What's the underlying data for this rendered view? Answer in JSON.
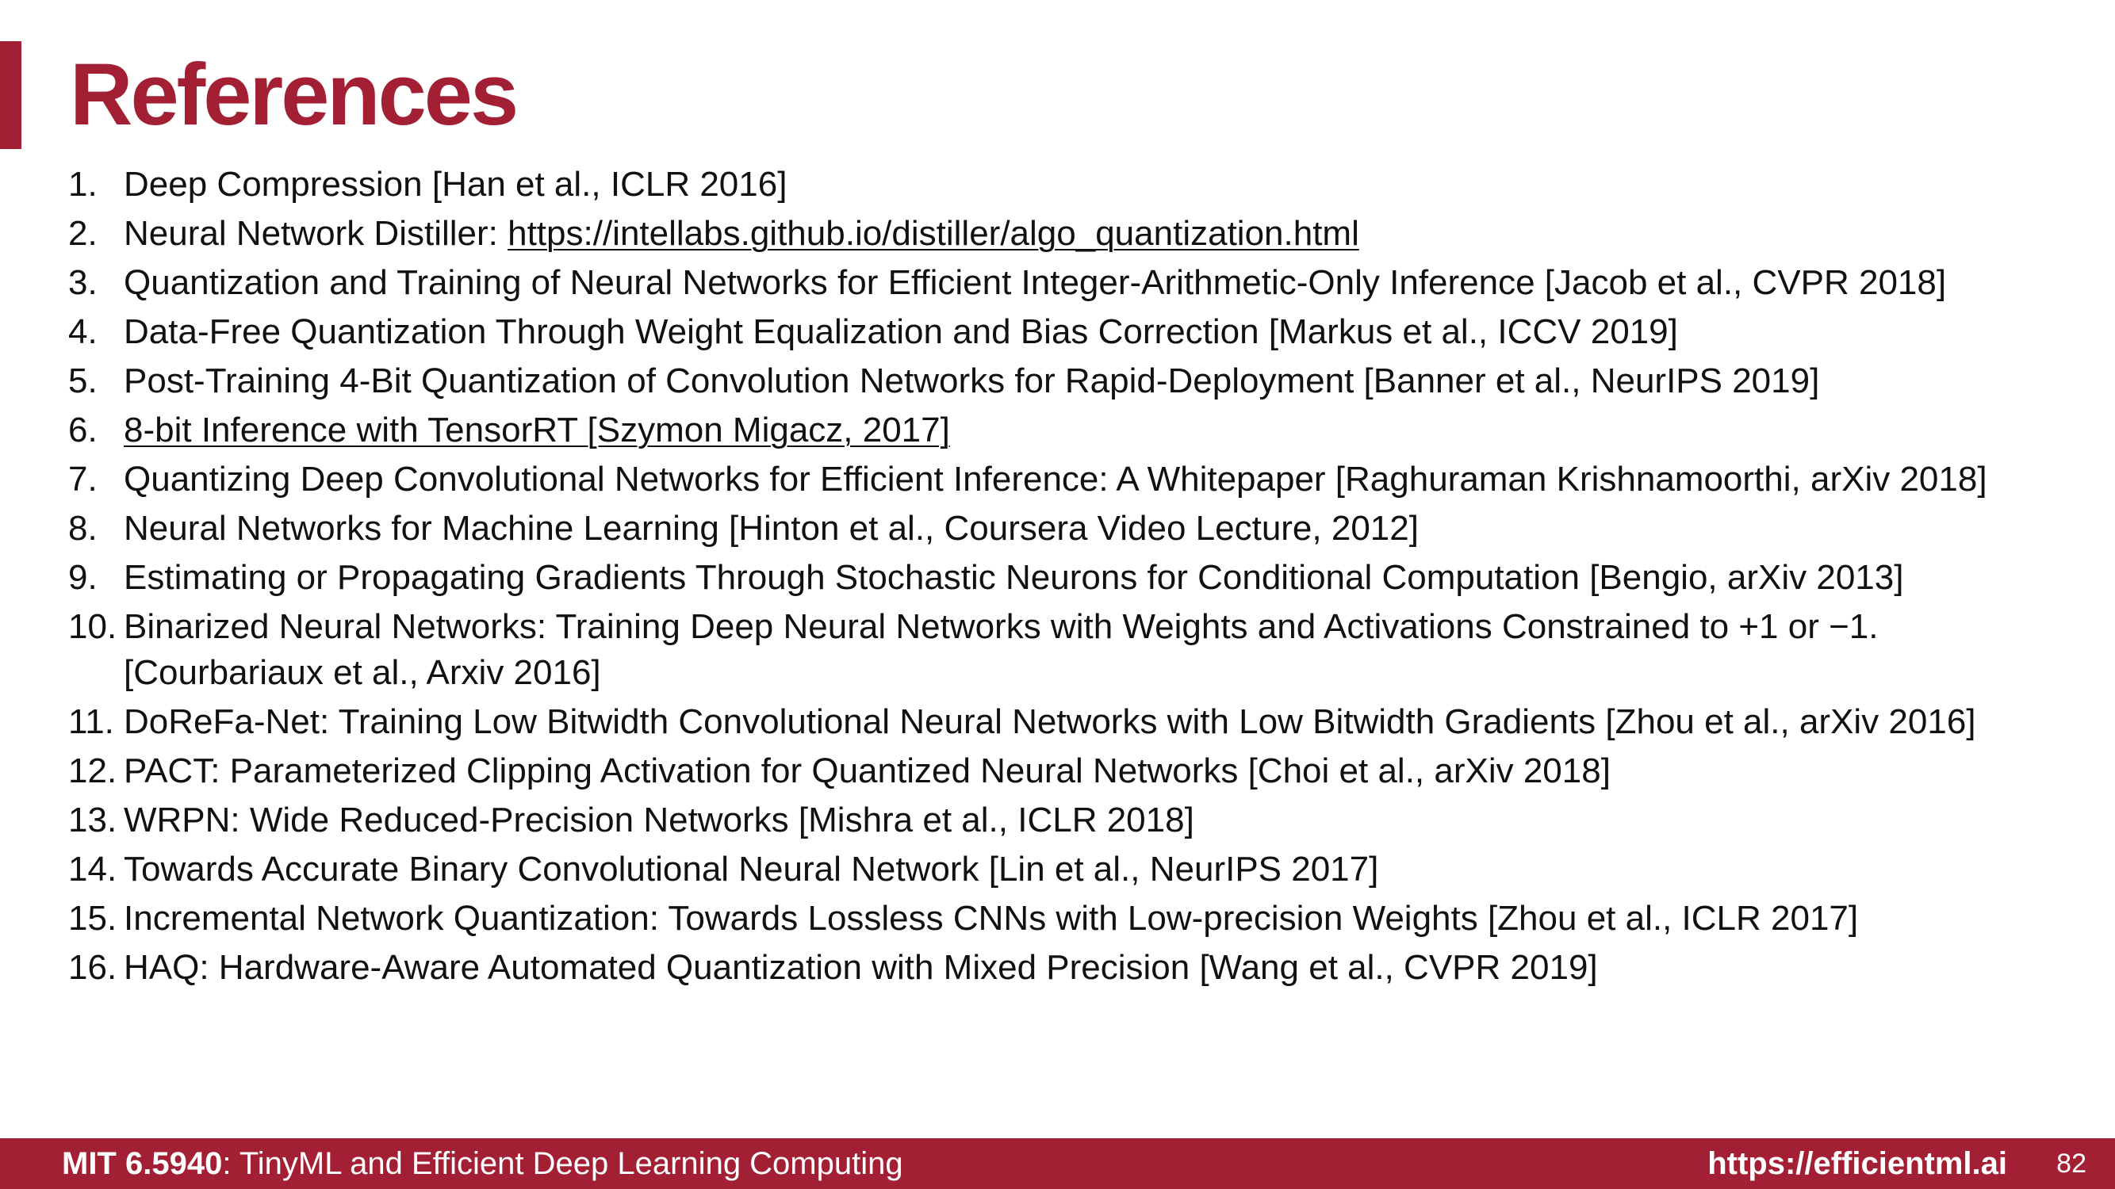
{
  "slide": {
    "title": "References",
    "accent_color": "#a31f34"
  },
  "references": [
    {
      "num": "1.",
      "parts": [
        {
          "text": "Deep Compression [Han et al., ICLR 2016]"
        }
      ]
    },
    {
      "num": "2.",
      "parts": [
        {
          "text": "Neural Network Distiller: "
        },
        {
          "text": "https://intellabs.github.io/distiller/algo_quantization.html",
          "link": true
        }
      ]
    },
    {
      "num": "3.",
      "parts": [
        {
          "text": "Quantization and Training of Neural Networks for Efficient Integer-Arithmetic-Only Inference  [Jacob et al., CVPR 2018]"
        }
      ]
    },
    {
      "num": "4.",
      "parts": [
        {
          "text": "Data-Free Quantization Through Weight Equalization and Bias Correction [Markus et al., ICCV 2019]"
        }
      ]
    },
    {
      "num": "5.",
      "parts": [
        {
          "text": "Post-Training 4-Bit Quantization of Convolution Networks for Rapid-Deployment [Banner et al., NeurIPS 2019]"
        }
      ]
    },
    {
      "num": "6.",
      "parts": [
        {
          "text": "8-bit Inference with TensorRT [Szymon Migacz, 2017]",
          "link": true
        }
      ]
    },
    {
      "num": "7.",
      "parts": [
        {
          "text": "Quantizing Deep Convolutional Networks for Efficient Inference: A Whitepaper  [Raghuraman Krishnamoorthi, arXiv 2018]"
        }
      ]
    },
    {
      "num": "8.",
      "parts": [
        {
          "text": "Neural Networks for Machine Learning [Hinton et al., Coursera Video Lecture, 2012]"
        }
      ]
    },
    {
      "num": "9.",
      "parts": [
        {
          "text": "Estimating or Propagating Gradients Through Stochastic Neurons for Conditional Computation [Bengio, arXiv 2013]"
        }
      ]
    },
    {
      "num": "10.",
      "parts": [
        {
          "text": "Binarized Neural Networks: Training Deep Neural Networks with Weights and Activations Constrained to +1 or −1. [Courbariaux et al., Arxiv 2016]"
        }
      ]
    },
    {
      "num": "11.",
      "parts": [
        {
          "text": "DoReFa-Net: Training Low Bitwidth Convolutional Neural Networks with Low Bitwidth Gradients [Zhou et al., arXiv 2016]"
        }
      ]
    },
    {
      "num": "12.",
      "parts": [
        {
          "text": "PACT: Parameterized Clipping Activation for Quantized Neural Networks [Choi et al., arXiv 2018]"
        }
      ]
    },
    {
      "num": "13.",
      "parts": [
        {
          "text": "WRPN: Wide Reduced-Precision Networks [Mishra et al., ICLR 2018]"
        }
      ]
    },
    {
      "num": "14.",
      "parts": [
        {
          "text": "Towards Accurate Binary Convolutional Neural Network [Lin et al., NeurIPS 2017]"
        }
      ]
    },
    {
      "num": "15.",
      "parts": [
        {
          "text": "Incremental Network Quantization: Towards Lossless CNNs with Low-precision Weights [Zhou et al., ICLR 2017]"
        }
      ]
    },
    {
      "num": "16.",
      "parts": [
        {
          "text": "HAQ: Hardware-Aware Automated Quantization with Mixed Precision [Wang et al., CVPR 2019]"
        }
      ]
    }
  ],
  "footer": {
    "course_code": "MIT 6.5940",
    "course_title": ": TinyML and Efficient Deep Learning Computing",
    "url": "https://efficientml.ai",
    "page_number": "82"
  }
}
